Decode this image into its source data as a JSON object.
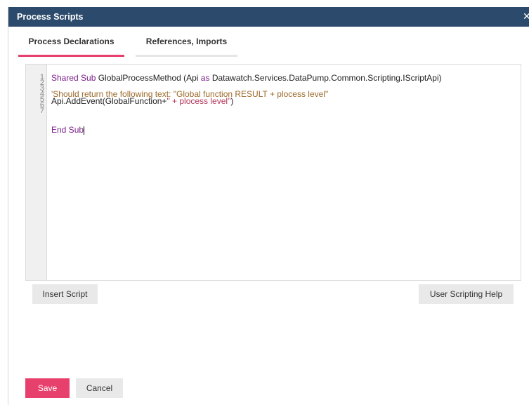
{
  "dialog": {
    "title": "Process Scripts",
    "close_glyph": "✕",
    "close_icon": "close-icon"
  },
  "tabs": [
    {
      "label": "Process Declarations",
      "active": true
    },
    {
      "label": "References, Imports",
      "active": false
    }
  ],
  "editor": {
    "line_numbers": [
      "1",
      "2",
      "3",
      "4",
      "5",
      "6",
      "7"
    ],
    "lines": {
      "l1_kw1": "Shared Sub",
      "l1_text1": " GlobalProcessMethod (Api ",
      "l1_kw2": "as",
      "l1_text2": " Datawatch.Services.DataPump.Common.Scripting.IScriptApi)",
      "l3_comment": "'Should return the following text: \"Global function RESULT + plocess level\"",
      "l4_text": "Api.AddEvent(GlobalFunction+",
      "l4_string": "\" + plocess level\"",
      "l4_close": ")",
      "l7_kw": "End Sub"
    }
  },
  "buttons": {
    "insert_script": "Insert Script",
    "user_scripting_help": "User Scripting Help",
    "save": "Save",
    "cancel": "Cancel"
  },
  "colors": {
    "titlebar": "#2c4a6b",
    "accent": "#e8406c",
    "keyword": "#7a1e8a",
    "comment": "#9b6a2a",
    "string": "#b2365a"
  }
}
